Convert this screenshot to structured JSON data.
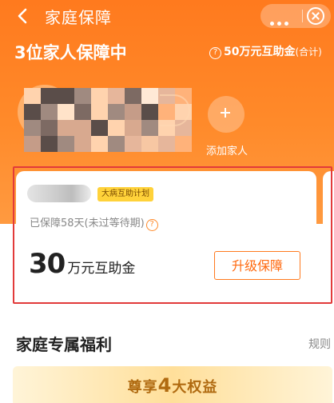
{
  "header": {
    "title": "家庭保障",
    "family_count_text": "3位家人保障中",
    "fund_amount": "50万元互助金",
    "fund_suffix": "(合计)",
    "help_glyph": "?",
    "add_member_label": "添加家人",
    "icons": {
      "back": "chevron-left-icon",
      "more": "more-dots-icon",
      "close": "close-circle-icon",
      "add": "plus-icon"
    }
  },
  "card": {
    "plan_badge": "大病互助计划",
    "protected_days_text": "已保障58天(未过等待期)",
    "help_glyph": "?",
    "amount_value": "30",
    "amount_unit": "万元互助金",
    "upgrade_label": "升级保障"
  },
  "benefits": {
    "title": "家庭专属福利",
    "rules_label": "规则",
    "banner_prefix": "尊享",
    "banner_number": "4",
    "banner_suffix": "大权益"
  },
  "colors": {
    "brand_orange": "#ff7a1e",
    "badge_yellow": "#ffd23a",
    "highlight_frame": "#e23a3a"
  }
}
